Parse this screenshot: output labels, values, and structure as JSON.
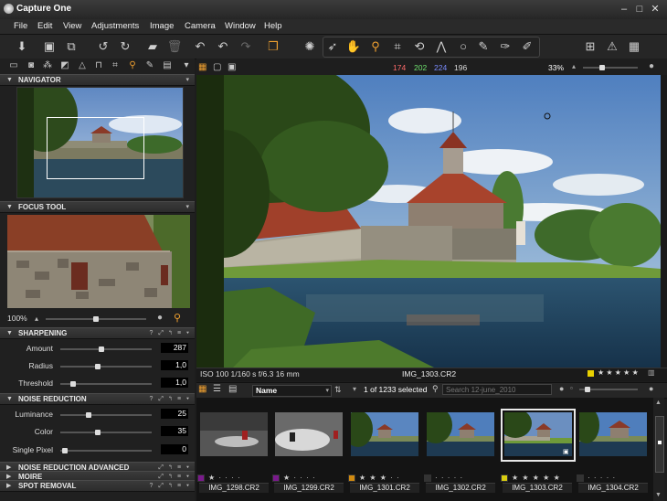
{
  "app": {
    "title": "Capture One"
  },
  "window_controls": {
    "minimize": "–",
    "maximize": "□",
    "close": "✕"
  },
  "menu": [
    "File",
    "Edit",
    "View",
    "Adjustments",
    "Image",
    "Camera",
    "Window",
    "Help"
  ],
  "toolbar_icons": [
    "import-icon",
    "capture-icon",
    "process-icon",
    "rotate-left-icon",
    "rotate-right-icon",
    "move-to-folder-icon",
    "trash-icon",
    "undo-icon",
    "undo-icon",
    "redo-icon",
    "compare-icon",
    "focus-mask-icon",
    "pointer-icon",
    "pan-icon",
    "zoom-icon",
    "crop-icon",
    "rotate-icon",
    "keystone-icon",
    "spot-icon",
    "picker-icon",
    "white-balance-icon",
    "apply-icon",
    "grid-icon",
    "exposure-warning-icon",
    "proof-icon"
  ],
  "readout": {
    "r": "174",
    "g": "202",
    "b": "224",
    "l": "196",
    "zoom": "33%"
  },
  "readout_colors": {
    "r": "#ff6b6b",
    "g": "#6ee06e",
    "b": "#7a8cff"
  },
  "panels": {
    "navigator": {
      "title": "NAVIGATOR"
    },
    "focus": {
      "title": "FOCUS TOOL",
      "zoom": "100%"
    },
    "sharpening": {
      "title": "SHARPENING",
      "rows": [
        {
          "label": "Amount",
          "value": "287",
          "level": 0.45
        },
        {
          "label": "Radius",
          "value": "1,0",
          "level": 0.4
        },
        {
          "label": "Threshold",
          "value": "1,0",
          "level": 0.12
        }
      ]
    },
    "noise": {
      "title": "NOISE REDUCTION",
      "rows": [
        {
          "label": "Luminance",
          "value": "25",
          "level": 0.3
        },
        {
          "label": "Color",
          "value": "35",
          "level": 0.4
        },
        {
          "label": "Single Pixel",
          "value": "0",
          "level": 0.02
        }
      ]
    },
    "collapsed": [
      "NOISE REDUCTION ADVANCED",
      "MOIRE",
      "SPOT REMOVAL"
    ]
  },
  "viewer": {
    "meta": "ISO 100  1/160 s  f/6.3  16 mm",
    "filename": "IMG_1303.CR2",
    "stars": "★ ★ ★ ★ ★",
    "label_color": "#e8d000"
  },
  "browser": {
    "sort": "Name",
    "count": "1 of 1233 selected",
    "search_placeholder": "Search 12-june_2010"
  },
  "thumbs": [
    {
      "name": "IMG_1298.CR2",
      "stars": "★ · · · ·",
      "color": "#7a1a8c",
      "selected": false
    },
    {
      "name": "IMG_1299.CR2",
      "stars": "★ · · · ·",
      "color": "#7a1a8c",
      "selected": false
    },
    {
      "name": "IMG_1301.CR2",
      "stars": "★ ★ ★ · ·",
      "color": "#d08a10",
      "selected": false
    },
    {
      "name": "IMG_1302.CR2",
      "stars": "· · · · ·",
      "color": "#333333",
      "selected": false
    },
    {
      "name": "IMG_1303.CR2",
      "stars": "★ ★ ★ ★ ★",
      "color": "#d8cc10",
      "selected": true
    },
    {
      "name": "IMG_1304.CR2",
      "stars": "· · · · ·",
      "color": "#333333",
      "selected": false
    }
  ]
}
